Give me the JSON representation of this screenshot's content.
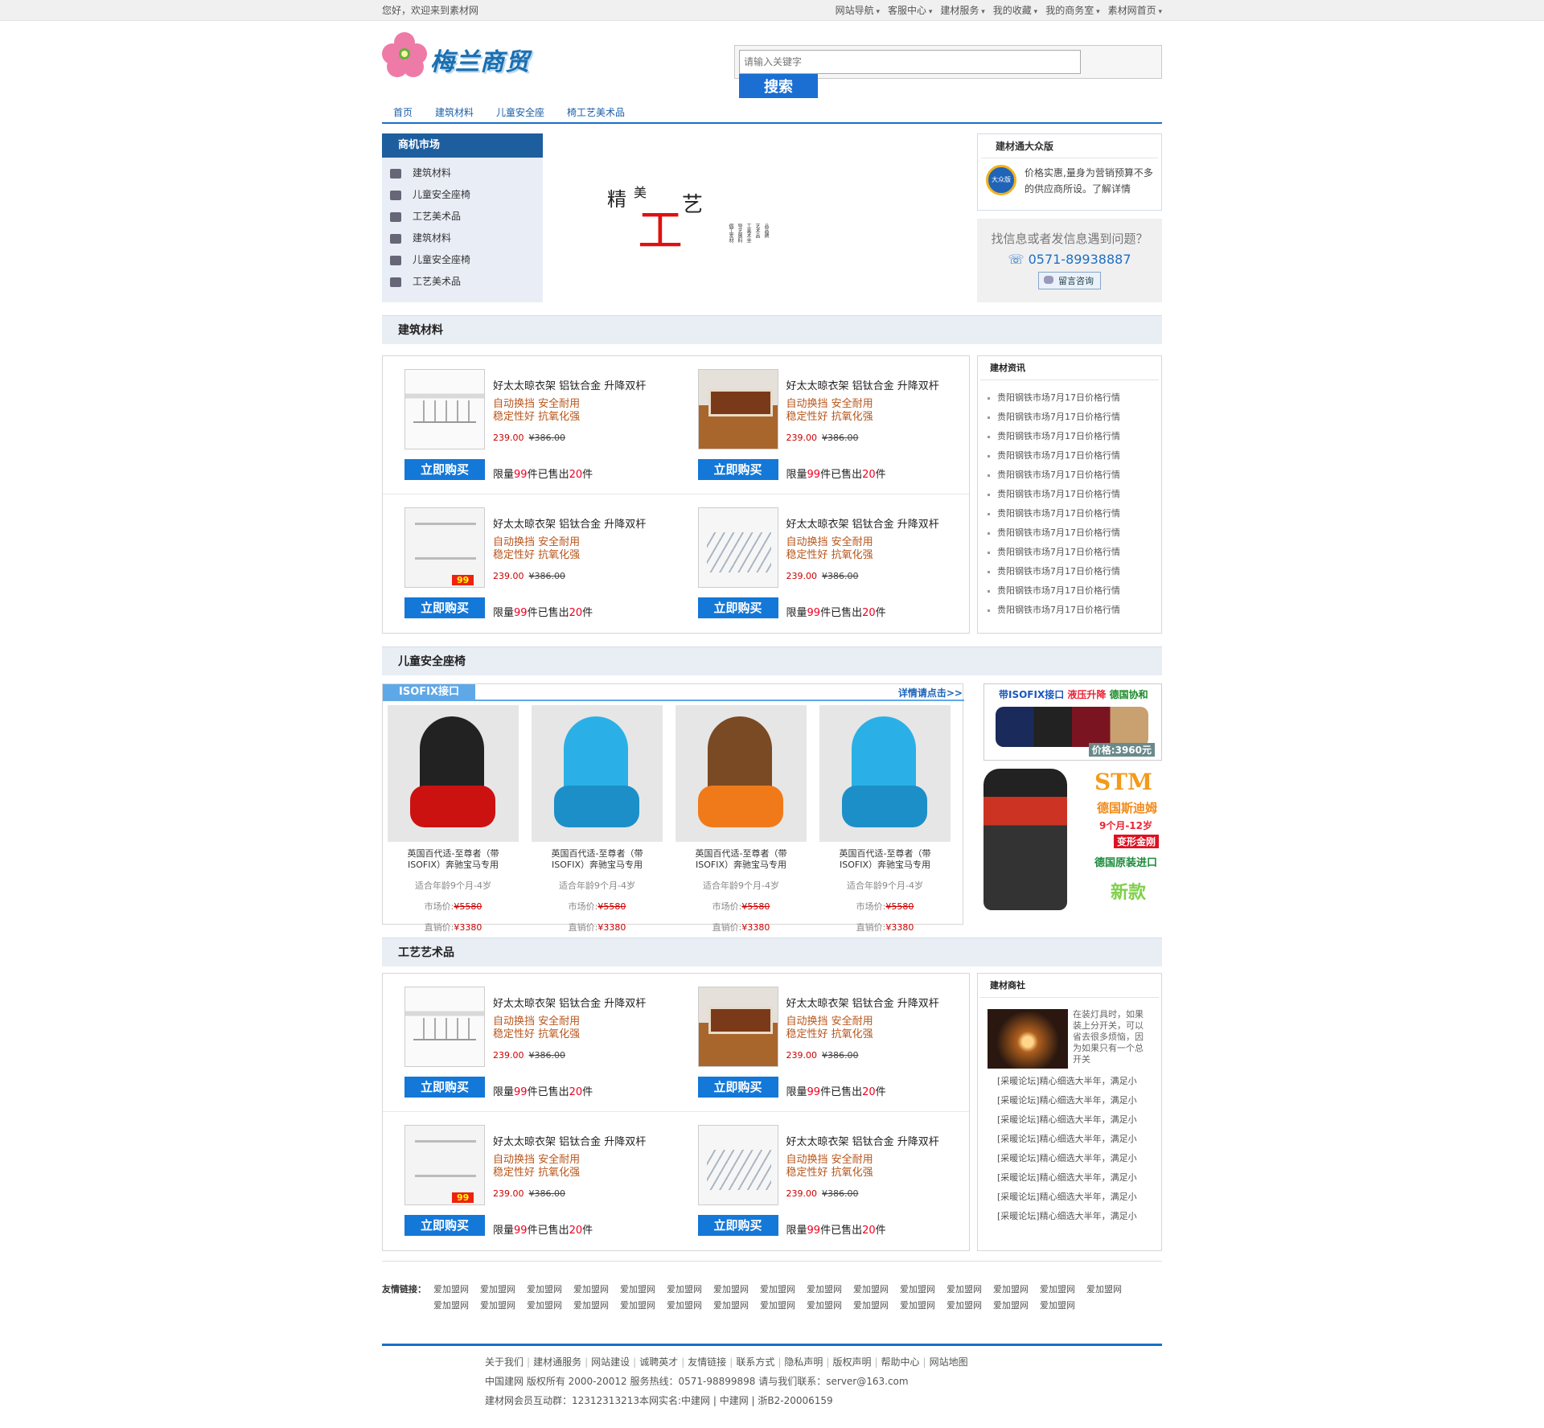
{
  "topbar": {
    "welcome": "您好，欢迎来到素材网",
    "nav": [
      "网站导航",
      "客服中心",
      "建材服务",
      "我的收藏",
      "我的商务室",
      "素材网首页"
    ]
  },
  "header": {
    "logo_text": "梅兰商贸",
    "search_placeholder": "请输入关键字",
    "search_button": "搜索"
  },
  "mainnav": [
    "首页",
    "建筑材料",
    "儿童安全座",
    "椅工艺美术品"
  ],
  "sidebar": {
    "title": "商机市场",
    "items": [
      {
        "label": "建筑材料",
        "icon": "cart-icon"
      },
      {
        "label": "儿童安全座椅",
        "icon": "car-icon"
      },
      {
        "label": "工艺美术品",
        "icon": "people-icon"
      },
      {
        "label": "建筑材料",
        "icon": "tools-icon"
      },
      {
        "label": "儿童安全座椅",
        "icon": "bag-icon"
      },
      {
        "label": "工艺美术品",
        "icon": "bank-icon"
      }
    ]
  },
  "banner": {
    "c1": "精",
    "c2": "美",
    "c3": "工",
    "c4": "艺",
    "vertical": [
      "倡工发材",
      "导艺展料",
      "工美术坐",
      "艺术品",
      "品品牌"
    ]
  },
  "dazhong": {
    "title": "建材通大众版",
    "badge": "大众版",
    "text": "价格实惠,量身为营销预算不多的供应商所设。了解详情"
  },
  "help": {
    "question": "找信息或者发信息遇到问题？",
    "phone": "0571-89938887",
    "button": "留言咨询"
  },
  "sections": {
    "building": "建筑材料",
    "childseat": "儿童安全座椅",
    "crafts": "工艺艺术品"
  },
  "product": {
    "title": "好太太晾衣架 铝钛合金 升降双杆",
    "sub1": "自动换挡 安全耐用",
    "sub2": "稳定性好 抗氧化强",
    "price": "239.00",
    "old_price": "¥386.00",
    "buy": "立即购买",
    "limit_pre": "限量",
    "limit_num": "99",
    "limit_mid": "件已售出",
    "sold_num": "20",
    "limit_post": "件"
  },
  "news": {
    "title": "建材资讯",
    "items": [
      "贵阳钢铁市场7月17日价格行情",
      "贵阳钢铁市场7月17日价格行情",
      "贵阳钢铁市场7月17日价格行情",
      "贵阳钢铁市场7月17日价格行情",
      "贵阳钢铁市场7月17日价格行情",
      "贵阳钢铁市场7月17日价格行情",
      "贵阳钢铁市场7月17日价格行情",
      "贵阳钢铁市场7月17日价格行情",
      "贵阳钢铁市场7月17日价格行情",
      "贵阳钢铁市场7月17日价格行情",
      "贵阳钢铁市场7月17日价格行情",
      "贵阳钢铁市场7月17日价格行情"
    ]
  },
  "seats": {
    "tag": "ISOFIX接口",
    "more": "详情请点击>>",
    "name": "英国百代适-至尊者（带ISOFIX）奔驰宝马专用",
    "age": "适合年龄9个月-4岁",
    "market_label": "市场价:",
    "market_price": "¥5580",
    "sale_label": "直销价:",
    "sale_price": "¥3380"
  },
  "ad1": {
    "t1": "带ISOFIX接口",
    "t2": "液压升降",
    "t3": "德国协和",
    "price": "价格:3960元"
  },
  "ad2": {
    "stm": "STM",
    "de": "德国斯迪姆",
    "age": "9个月-12岁",
    "kg": "变形金刚",
    "yz": "德国原装进口",
    "xk": "新款"
  },
  "shangshe": {
    "title": "建材商社",
    "intro": "在装灯具时，如果装上分开关，可以省去很多烦恼，因为如果只有一个总开关",
    "items": [
      "[采暖论坛]精心细选大半年，满足小",
      "[采暖论坛]精心细选大半年，满足小",
      "[采暖论坛]精心细选大半年，满足小",
      "[采暖论坛]精心细选大半年，满足小",
      "[采暖论坛]精心细选大半年，满足小",
      "[采暖论坛]精心细选大半年，满足小",
      "[采暖论坛]精心细选大半年，满足小",
      "[采暖论坛]精心细选大半年，满足小"
    ]
  },
  "links": {
    "label": "友情链接：",
    "items": [
      "爱加盟网",
      "爱加盟网",
      "爱加盟网",
      "爱加盟网",
      "爱加盟网",
      "爱加盟网",
      "爱加盟网",
      "爱加盟网",
      "爱加盟网",
      "爱加盟网",
      "爱加盟网",
      "爱加盟网",
      "爱加盟网",
      "爱加盟网",
      "爱加盟网",
      "爱加盟网",
      "爱加盟网",
      "爱加盟网",
      "爱加盟网",
      "爱加盟网",
      "爱加盟网",
      "爱加盟网",
      "爱加盟网",
      "爱加盟网",
      "爱加盟网",
      "爱加盟网",
      "爱加盟网",
      "爱加盟网",
      "爱加盟网"
    ]
  },
  "footer": {
    "links": [
      "关于我们",
      "建材通服务",
      "网站建设",
      "诚聘英才",
      "友情链接",
      "联系方式",
      "隐私声明",
      "版权声明",
      "帮助中心",
      "网站地图"
    ],
    "line2": "中国建网 版权所有 2000-20012 服务热线：0571-98899898 请与我们联系：server@163.com",
    "line3": "建材网会员互动群：12312313213本网实名:中建网 | 中建网 | 浙B2-20006159"
  }
}
